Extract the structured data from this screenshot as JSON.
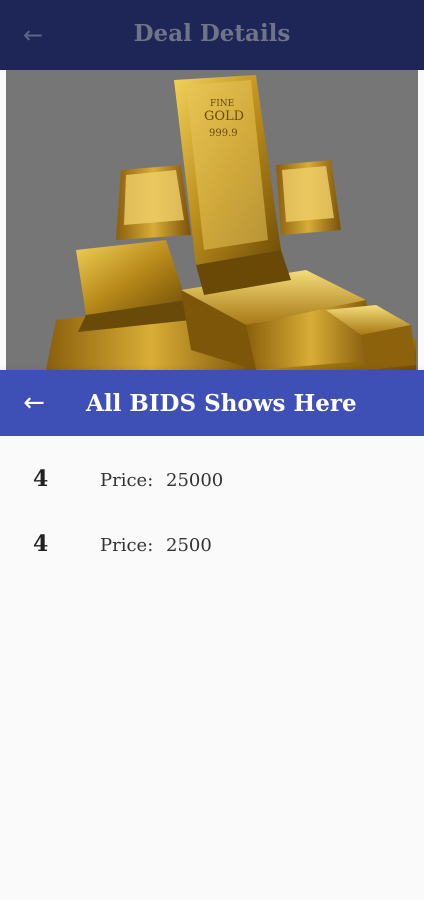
{
  "background_screen": {
    "title": "Deal Details",
    "back_icon": "arrow-left-icon",
    "image": {
      "subject": "gold-bars-image",
      "bar_text": [
        "FINE",
        "GOLD",
        "999.9"
      ]
    }
  },
  "bids_sheet": {
    "title": "All BIDS Shows Here",
    "back_icon": "arrow-left-icon",
    "accent_color": "#3e50b5",
    "bids": [
      {
        "count": "4",
        "price_label": "Price:",
        "price_value": "25000"
      },
      {
        "count": "4",
        "price_label": "Price:",
        "price_value": "2500"
      }
    ]
  }
}
